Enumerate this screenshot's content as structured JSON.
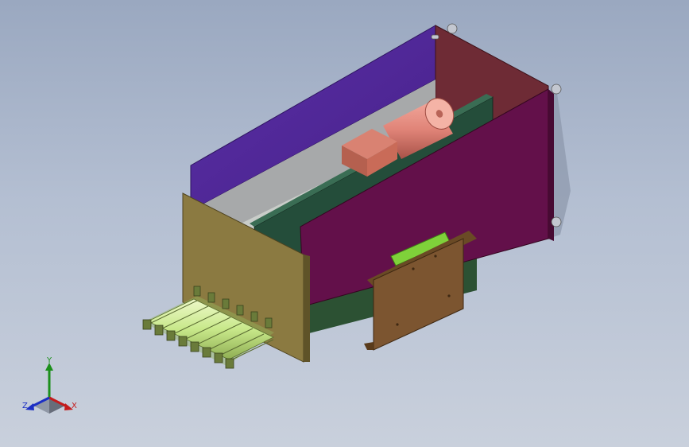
{
  "viewport": {
    "background_top": "#9aa8c0",
    "background_bottom": "#c9d0dc"
  },
  "colors": {
    "back_panel": "#53299a",
    "side_panel": "#63104a",
    "end_panel": "#6e2b35",
    "front_panel": "#8b7a41",
    "rail": "#244d3a",
    "motor": "#e08478",
    "gearbox": "#c96b58",
    "bracket": "#7c5530",
    "tubes": "#c8e88a",
    "hardware": "#c3c7d0"
  },
  "triad": {
    "y_label": "Y",
    "x_label": "X",
    "z_label": "Z",
    "y_color": "#1b8f1b",
    "x_color": "#c41c1c",
    "z_color": "#1c2fc4"
  }
}
